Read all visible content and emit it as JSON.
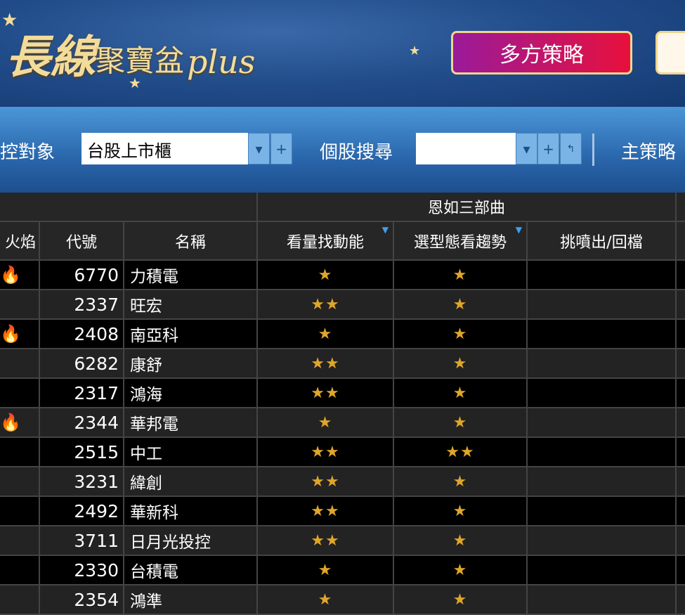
{
  "banner": {
    "logo_big": "長線",
    "logo_mid": "聚寶盆",
    "logo_plus": "plus",
    "multi_button": "多方策略"
  },
  "toolbar": {
    "monitor_label": "監控對象",
    "monitor_value": "台股上市櫃",
    "search_label": "個股搜尋",
    "search_value": "",
    "main_strategy_label": "主策略"
  },
  "table": {
    "group_header": "恩如三部曲",
    "columns": [
      "火焰",
      "代號",
      "名稱",
      "看量找動能",
      "選型態看趨勢",
      "挑噴出/回檔"
    ],
    "rows": [
      {
        "fire": true,
        "code": "6770",
        "name": "力積電",
        "volume": "★",
        "pattern": "★",
        "pick": ""
      },
      {
        "fire": false,
        "code": "2337",
        "name": "旺宏",
        "volume": "★★",
        "pattern": "★",
        "pick": ""
      },
      {
        "fire": true,
        "code": "2408",
        "name": "南亞科",
        "volume": "★",
        "pattern": "★",
        "pick": ""
      },
      {
        "fire": false,
        "code": "6282",
        "name": "康舒",
        "volume": "★★",
        "pattern": "★",
        "pick": ""
      },
      {
        "fire": false,
        "code": "2317",
        "name": "鴻海",
        "volume": "★★",
        "pattern": "★",
        "pick": ""
      },
      {
        "fire": true,
        "code": "2344",
        "name": "華邦電",
        "volume": "★",
        "pattern": "★",
        "pick": ""
      },
      {
        "fire": false,
        "code": "2515",
        "name": "中工",
        "volume": "★★",
        "pattern": "★★",
        "pick": ""
      },
      {
        "fire": false,
        "code": "3231",
        "name": "緯創",
        "volume": "★★",
        "pattern": "★",
        "pick": ""
      },
      {
        "fire": false,
        "code": "2492",
        "name": "華新科",
        "volume": "★★",
        "pattern": "★",
        "pick": ""
      },
      {
        "fire": false,
        "code": "3711",
        "name": "日月光投控",
        "volume": "★★",
        "pattern": "★",
        "pick": ""
      },
      {
        "fire": false,
        "code": "2330",
        "name": "台積電",
        "volume": "★",
        "pattern": "★",
        "pick": ""
      },
      {
        "fire": false,
        "code": "2354",
        "name": "鴻準",
        "volume": "★",
        "pattern": "★",
        "pick": ""
      }
    ]
  }
}
